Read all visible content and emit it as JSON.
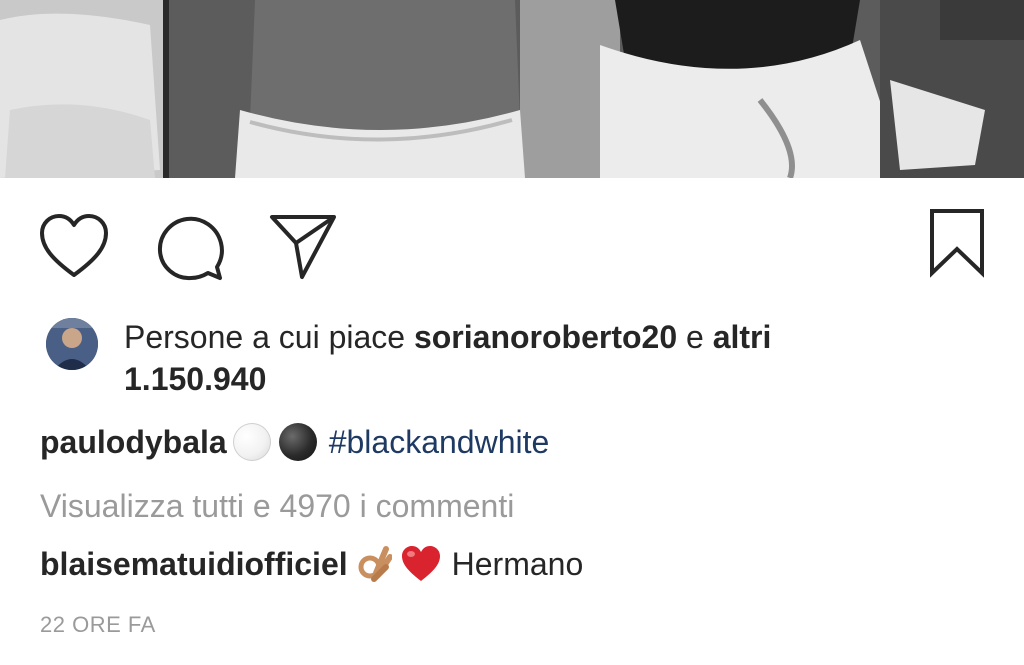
{
  "post": {
    "photo": {
      "description_icon": "post-photo"
    },
    "actions": {
      "like_icon": "heart-outline-icon",
      "comment_icon": "speech-bubble-icon",
      "share_icon": "paper-plane-icon",
      "save_icon": "bookmark-icon"
    },
    "likes": {
      "prefix": "Persone a cui piace",
      "first_user": "sorianoroberto20",
      "conjunction": "e",
      "others_label": "altri",
      "count": "1.150.940"
    },
    "caption": {
      "username": "paulodybala",
      "emojis": [
        "white-circle-emoji",
        "black-circle-emoji"
      ],
      "hashtag": "#blackandwhite"
    },
    "view_all_comments": "Visualizza tutti e 4970 i commenti",
    "top_comment": {
      "username": "blaisematuidiofficiel",
      "emojis": [
        "ok-hand-emoji",
        "red-heart-emoji"
      ],
      "text": "Hermano"
    },
    "timestamp": "22 ORE FA"
  },
  "colors": {
    "text": "#262626",
    "muted": "#9a9a9a",
    "hashtag": "#1e3a63",
    "heart": "#d9232f"
  }
}
